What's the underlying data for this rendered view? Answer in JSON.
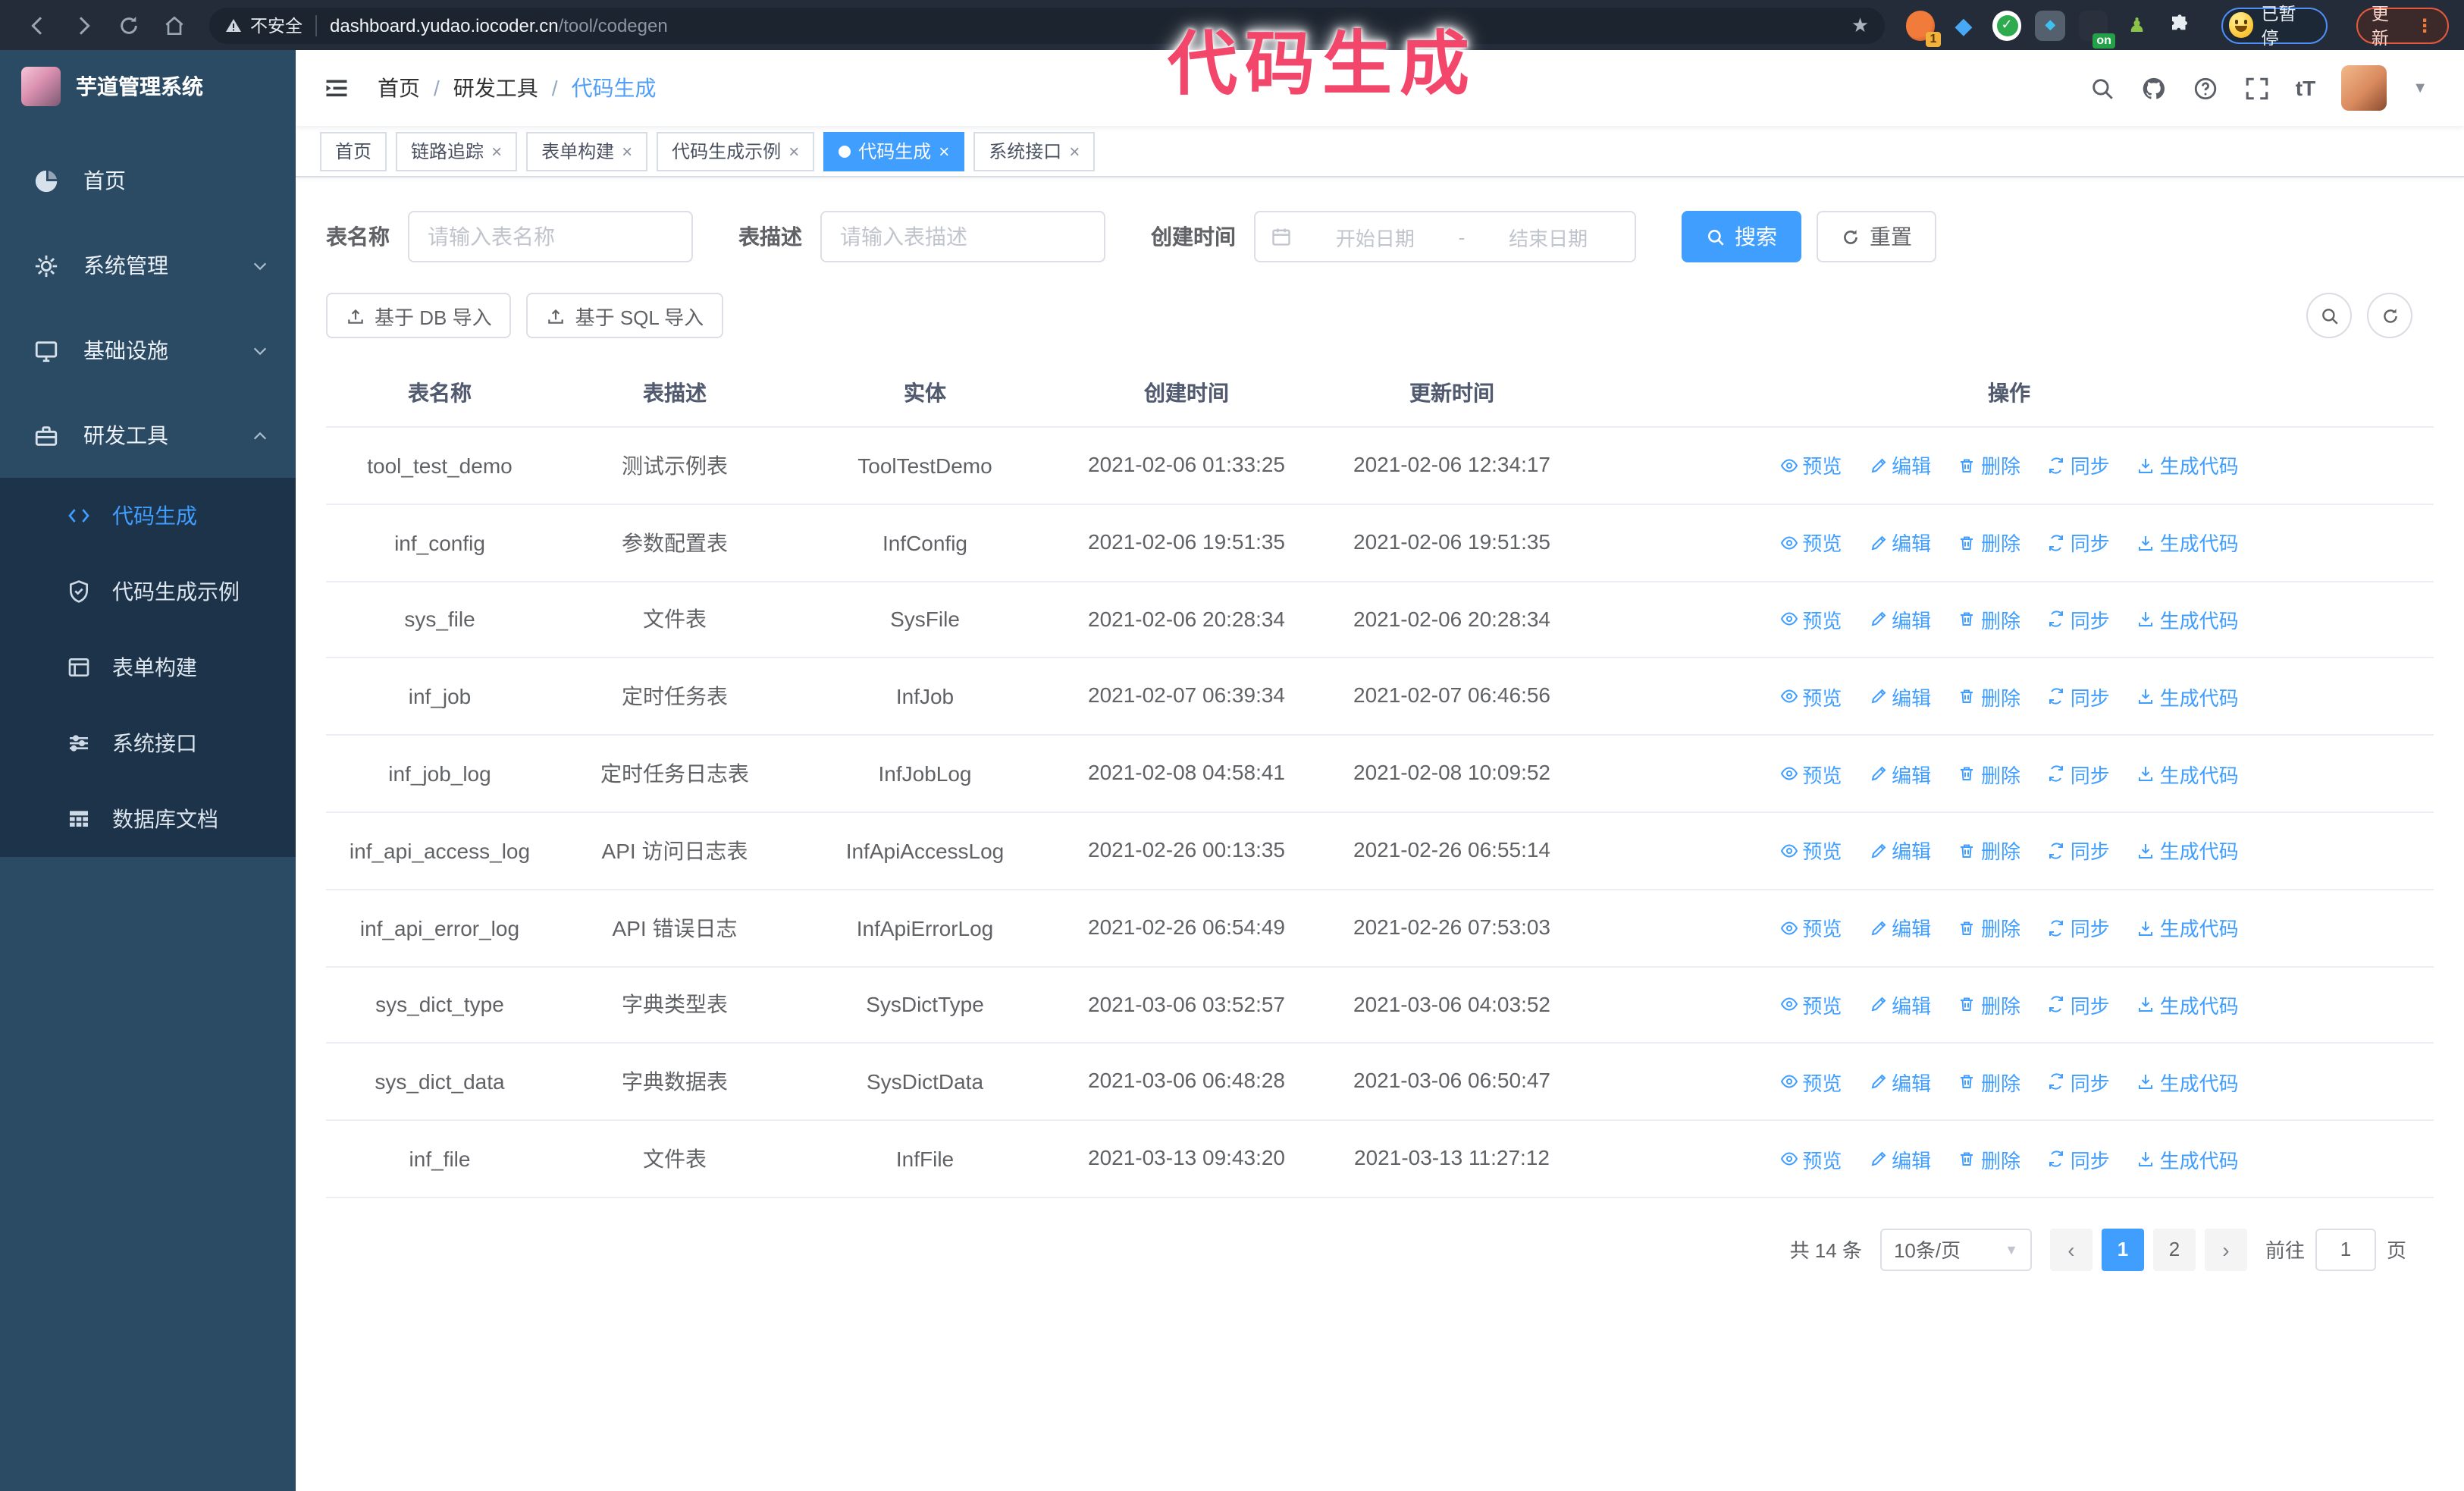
{
  "colors": {
    "accent": "#409EFF",
    "annotation_pink": "#F2476B",
    "sidebar_bg": "#2B4A63",
    "submenu_bg": "#1D3349",
    "toolbar_bg": "#242C3A"
  },
  "browser": {
    "security_label": "不安全",
    "url_host": "dashboard.yudao.iocoder.cn",
    "url_path": "/tool/codegen",
    "extension_badge": "1",
    "extension_on_badge": "on",
    "paused_label": "已暂停",
    "update_label": "更新"
  },
  "annotation": {
    "text": "代码生成"
  },
  "sidebar": {
    "title": "芋道管理系统",
    "menu": [
      {
        "label": "首页"
      },
      {
        "label": "系统管理"
      },
      {
        "label": "基础设施"
      },
      {
        "label": "研发工具"
      }
    ],
    "submenu": [
      {
        "label": "代码生成"
      },
      {
        "label": "代码生成示例"
      },
      {
        "label": "表单构建"
      },
      {
        "label": "系统接口"
      },
      {
        "label": "数据库文档"
      }
    ]
  },
  "breadcrumb": {
    "items": [
      "首页",
      "研发工具",
      "代码生成"
    ],
    "separator": "/"
  },
  "tags": [
    {
      "label": "首页"
    },
    {
      "label": "链路追踪"
    },
    {
      "label": "表单构建"
    },
    {
      "label": "代码生成示例"
    },
    {
      "label": "代码生成"
    },
    {
      "label": "系统接口"
    }
  ],
  "filters": {
    "name_label": "表名称",
    "name_placeholder": "请输入表名称",
    "desc_label": "表描述",
    "desc_placeholder": "请输入表描述",
    "time_label": "创建时间",
    "start_placeholder": "开始日期",
    "range_separator": "-",
    "end_placeholder": "结束日期",
    "search_label": "搜索",
    "reset_label": "重置"
  },
  "import_buttons": {
    "db": "基于 DB 导入",
    "sql": "基于 SQL 导入"
  },
  "table": {
    "columns": [
      "表名称",
      "表描述",
      "实体",
      "创建时间",
      "更新时间",
      "操作"
    ],
    "actions": [
      "预览",
      "编辑",
      "删除",
      "同步",
      "生成代码"
    ],
    "rows": [
      {
        "name": "tool_test_demo",
        "desc": "测试示例表",
        "entity": "ToolTestDemo",
        "created": "2021-02-06 01:33:25",
        "updated": "2021-02-06 12:34:17"
      },
      {
        "name": "inf_config",
        "desc": "参数配置表",
        "entity": "InfConfig",
        "created": "2021-02-06 19:51:35",
        "updated": "2021-02-06 19:51:35"
      },
      {
        "name": "sys_file",
        "desc": "文件表",
        "entity": "SysFile",
        "created": "2021-02-06 20:28:34",
        "updated": "2021-02-06 20:28:34"
      },
      {
        "name": "inf_job",
        "desc": "定时任务表",
        "entity": "InfJob",
        "created": "2021-02-07 06:39:34",
        "updated": "2021-02-07 06:46:56"
      },
      {
        "name": "inf_job_log",
        "desc": "定时任务日志表",
        "entity": "InfJobLog",
        "created": "2021-02-08 04:58:41",
        "updated": "2021-02-08 10:09:52"
      },
      {
        "name": "inf_api_access_log",
        "desc": "API 访问日志表",
        "entity": "InfApiAccessLog",
        "created": "2021-02-26 00:13:35",
        "updated": "2021-02-26 06:55:14"
      },
      {
        "name": "inf_api_error_log",
        "desc": "API 错误日志",
        "entity": "InfApiErrorLog",
        "created": "2021-02-26 06:54:49",
        "updated": "2021-02-26 07:53:03"
      },
      {
        "name": "sys_dict_type",
        "desc": "字典类型表",
        "entity": "SysDictType",
        "created": "2021-03-06 03:52:57",
        "updated": "2021-03-06 04:03:52"
      },
      {
        "name": "sys_dict_data",
        "desc": "字典数据表",
        "entity": "SysDictData",
        "created": "2021-03-06 06:48:28",
        "updated": "2021-03-06 06:50:47"
      },
      {
        "name": "inf_file",
        "desc": "文件表",
        "entity": "InfFile",
        "created": "2021-03-13 09:43:20",
        "updated": "2021-03-13 11:27:12"
      }
    ]
  },
  "pagination": {
    "total": "共 14 条",
    "page_size": "10条/页",
    "pages": [
      "1",
      "2"
    ],
    "current_page": "1",
    "goto_label": "前往",
    "goto_value": "1",
    "goto_suffix": "页"
  }
}
